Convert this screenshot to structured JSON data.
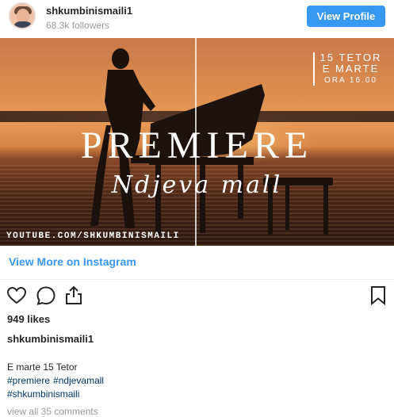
{
  "header": {
    "username": "shkumbinismaili1",
    "followers": "68.3k followers",
    "view_profile_label": "View Profile"
  },
  "post_image": {
    "title": "PREMIERE",
    "subtitle": "Ndjeva mall",
    "event_line1": "15 TETOR",
    "event_line2": "E MARTE",
    "event_line3": "ORA 16.00",
    "watermark": "YOUTUBE.COM/SHKUMBINISMAILI"
  },
  "view_more_label": "View More on Instagram",
  "actions": {
    "like_icon": "heart-icon",
    "comment_icon": "comment-icon",
    "share_icon": "share-icon",
    "save_icon": "bookmark-icon"
  },
  "likes": "949 likes",
  "caption": {
    "username": "shkumbinismaili1",
    "text": "E marte 15 Tetor",
    "hashtags_line1": [
      "#premiere",
      "#ndjevamall"
    ],
    "hashtags_line2": "#shkumbinismaili"
  },
  "comments_link": "view all 35 comments",
  "colors": {
    "accent": "#3897f0",
    "hashtag": "#003569",
    "muted": "#999999"
  }
}
